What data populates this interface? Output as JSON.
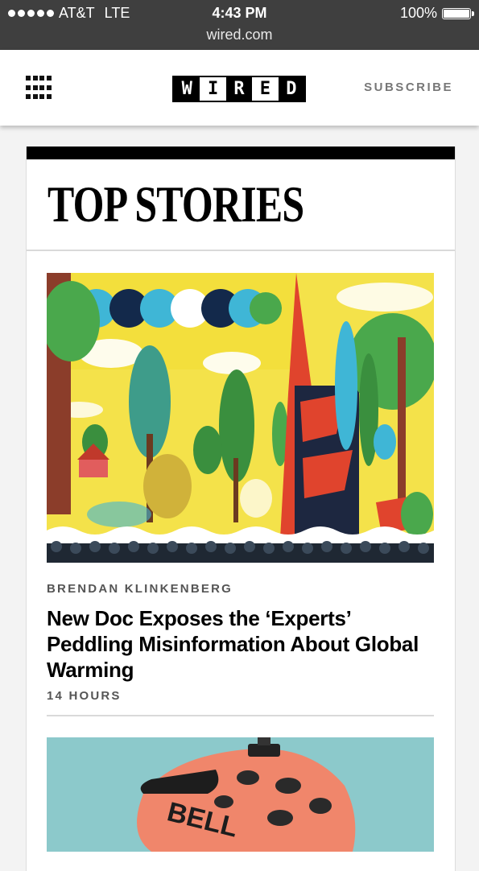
{
  "status_bar": {
    "carrier": "AT&T",
    "network": "LTE",
    "time": "4:43 PM",
    "battery": "100%",
    "url": "wired.com"
  },
  "header": {
    "menu_icon": "grid-menu-icon",
    "logo_letters": [
      "W",
      "I",
      "R",
      "E",
      "D"
    ],
    "subscribe_label": "SUBSCRIBE"
  },
  "section": {
    "title": "TOP STORIES"
  },
  "stories": [
    {
      "author": "BRENDAN KLINKENBERG",
      "headline": "New Doc Exposes the ‘Experts’ Peddling Misinformation About Global Warming",
      "time": "14 HOURS",
      "image": "climate-illustration"
    },
    {
      "image": "bike-helmet-photo"
    }
  ],
  "colors": {
    "status_bar_bg": "#3f3f3f",
    "accent_black": "#000000",
    "meta_gray": "#555555",
    "page_bg": "#f3f3f3"
  }
}
